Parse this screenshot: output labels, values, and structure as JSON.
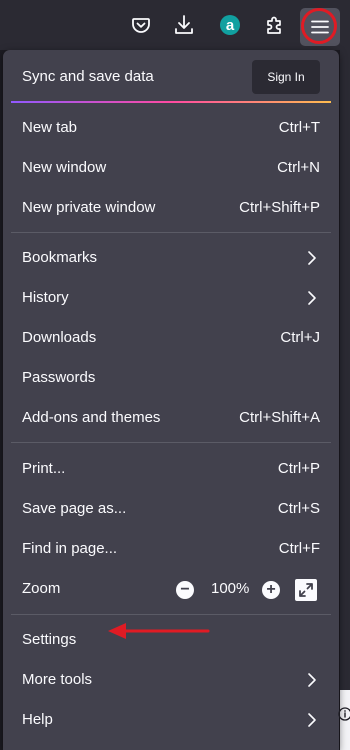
{
  "toolbar": {
    "icons": [
      "pocket-icon",
      "download-icon",
      "extension-a-icon",
      "extensions-puzzle-icon",
      "hamburger-menu-icon"
    ],
    "ext_letter": "a",
    "colors": {
      "background": "#2b2a33",
      "highlight_ring": "#e01b24",
      "ext_badge": "#11a0a0"
    }
  },
  "menu": {
    "sync_title": "Sync and save data",
    "sign_in": "Sign In",
    "items": [
      {
        "label": "New tab",
        "shortcut": "Ctrl+T"
      },
      {
        "label": "New window",
        "shortcut": "Ctrl+N"
      },
      {
        "label": "New private window",
        "shortcut": "Ctrl+Shift+P"
      },
      {
        "label": "Bookmarks",
        "shortcut": ""
      },
      {
        "label": "History",
        "shortcut": ""
      },
      {
        "label": "Downloads",
        "shortcut": "Ctrl+J"
      },
      {
        "label": "Passwords",
        "shortcut": ""
      },
      {
        "label": "Add-ons and themes",
        "shortcut": "Ctrl+Shift+A"
      },
      {
        "label": "Print...",
        "shortcut": "Ctrl+P"
      },
      {
        "label": "Save page as...",
        "shortcut": "Ctrl+S"
      },
      {
        "label": "Find in page...",
        "shortcut": "Ctrl+F"
      },
      {
        "label": "Zoom",
        "shortcut": ""
      },
      {
        "label": "Settings",
        "shortcut": ""
      },
      {
        "label": "More tools",
        "shortcut": ""
      },
      {
        "label": "Help",
        "shortcut": ""
      }
    ],
    "zoom_minus": "−",
    "zoom_value": "100%",
    "zoom_plus": "+",
    "colors": {
      "panel": "#42414d",
      "text": "#fbfbfe",
      "separator": "#5b5b66",
      "annotation_arrow": "#e01b24"
    }
  }
}
